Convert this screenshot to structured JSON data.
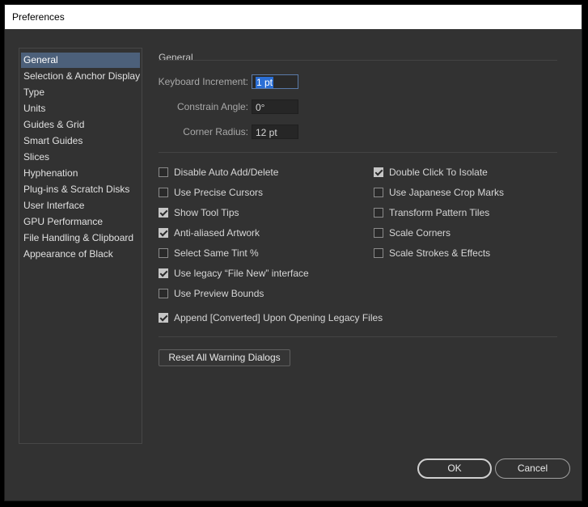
{
  "window": {
    "title": "Preferences"
  },
  "sidebar": {
    "items": [
      {
        "label": "General",
        "selected": true
      },
      {
        "label": "Selection & Anchor Display"
      },
      {
        "label": "Type"
      },
      {
        "label": "Units"
      },
      {
        "label": "Guides & Grid"
      },
      {
        "label": "Smart Guides"
      },
      {
        "label": "Slices"
      },
      {
        "label": "Hyphenation"
      },
      {
        "label": "Plug-ins & Scratch Disks"
      },
      {
        "label": "User Interface"
      },
      {
        "label": "GPU Performance"
      },
      {
        "label": "File Handling & Clipboard"
      },
      {
        "label": "Appearance of Black"
      }
    ]
  },
  "general": {
    "section_title": "General",
    "keyboard_increment": {
      "label": "Keyboard Increment:",
      "value": "1 pt"
    },
    "constrain_angle": {
      "label": "Constrain Angle:",
      "value": "0°"
    },
    "corner_radius": {
      "label": "Corner Radius:",
      "value": "12 pt"
    },
    "checkboxes": {
      "disable_auto_add": {
        "label": "Disable Auto Add/Delete",
        "checked": false
      },
      "precise_cursors": {
        "label": "Use Precise Cursors",
        "checked": false
      },
      "tool_tips": {
        "label": "Show Tool Tips",
        "checked": true
      },
      "anti_aliased": {
        "label": "Anti-aliased Artwork",
        "checked": true
      },
      "same_tint": {
        "label": "Select Same Tint %",
        "checked": false
      },
      "legacy_file_new": {
        "label": "Use legacy “File New” interface",
        "checked": true
      },
      "preview_bounds": {
        "label": "Use Preview Bounds",
        "checked": false
      },
      "append_converted": {
        "label": "Append [Converted] Upon Opening Legacy Files",
        "checked": true
      },
      "double_click_isolate": {
        "label": "Double Click To Isolate",
        "checked": true
      },
      "japanese_crop": {
        "label": "Use Japanese Crop Marks",
        "checked": false
      },
      "transform_pattern": {
        "label": "Transform Pattern Tiles",
        "checked": false
      },
      "scale_corners": {
        "label": "Scale Corners",
        "checked": false
      },
      "scale_strokes": {
        "label": "Scale Strokes & Effects",
        "checked": false
      }
    },
    "reset_button": "Reset All Warning Dialogs"
  },
  "footer": {
    "ok": "OK",
    "cancel": "Cancel"
  },
  "colors": {
    "background": "#323232",
    "selection": "#4c607a",
    "text_highlight": "#2b6fd6"
  }
}
